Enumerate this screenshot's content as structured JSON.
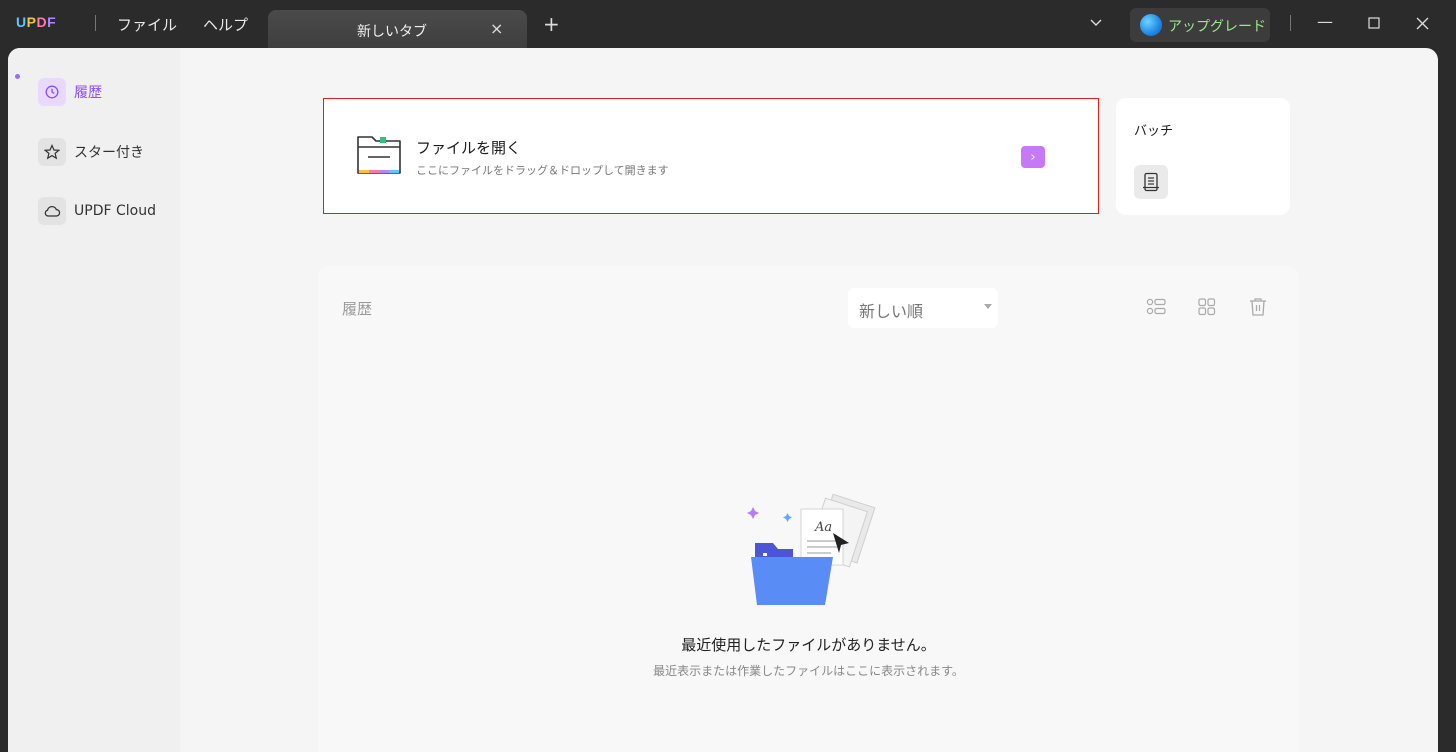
{
  "app": {
    "logo": "UPDF"
  },
  "menu": {
    "file": "ファイル",
    "help": "ヘルプ"
  },
  "tab": {
    "label": "新しいタブ",
    "close": "×",
    "new": "+"
  },
  "upgrade": {
    "label": "アップグレード"
  },
  "window_controls": {
    "minimize": "—",
    "maximize": "☐",
    "close": "✕"
  },
  "sidebar": {
    "items": [
      {
        "label": "履歴",
        "icon": "clock-icon",
        "active": true
      },
      {
        "label": "スター付き",
        "icon": "star-icon",
        "active": false
      },
      {
        "label": "UPDF Cloud",
        "icon": "cloud-icon",
        "active": false
      }
    ]
  },
  "open_file": {
    "title": "ファイルを開く",
    "subtitle": "ここにファイルをドラッグ＆ドロップして開きます",
    "arrow": "›"
  },
  "batch": {
    "title": "バッチ",
    "icon": "batch-document-icon"
  },
  "history": {
    "title": "履歴",
    "sort_selected": "新しい順",
    "empty_title": "最近使用したファイルがありません。",
    "empty_subtitle": "最近表示または作業したファイルはここに表示されます。"
  },
  "colors": {
    "accent": "#8b4dff",
    "arrow": "#c679f5",
    "highlight_border": "#e01e1e"
  }
}
